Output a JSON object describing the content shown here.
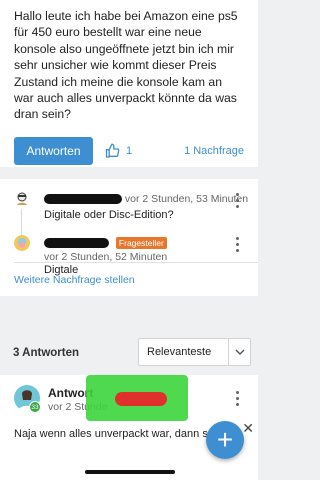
{
  "question": {
    "text": "Hallo leute ich habe bei Amazon eine ps5 für 450 euro bestellt war eine neue konsole also ungeöffnete jetzt bin ich mir sehr unsicher wie kommt dieser Preis Zustand ich meine die konsole kam an war auch alles unverpackt könnte da was dran sein?",
    "answer_button": "Antworten",
    "like_count": "1",
    "followup_count": "1 Nachfrage"
  },
  "followups": {
    "items": [
      {
        "meta": "vor 2 Stunden, 53 Minuten",
        "text": "Digitale oder Disc-Edition?"
      },
      {
        "badge": "Fragesteller",
        "meta": "vor 2 Stunden, 52 Minuten",
        "text": "Digtale"
      }
    ],
    "more_link": "Weitere Nachfrage stellen"
  },
  "answers": {
    "count_label": "3 Antworten",
    "sort_selected": "Relevanteste"
  },
  "answer": {
    "title": "Antwort",
    "meta": "vor 2 Stunde",
    "level": "33",
    "text": "Naja wenn alles unverpackt war, dann so"
  },
  "colors": {
    "accent": "#3d8fd1",
    "badge": "#e8772e"
  },
  "icons": [
    "thumbs-up-icon",
    "more-vertical-icon",
    "chevron-down-icon",
    "plus-icon",
    "close-icon"
  ]
}
